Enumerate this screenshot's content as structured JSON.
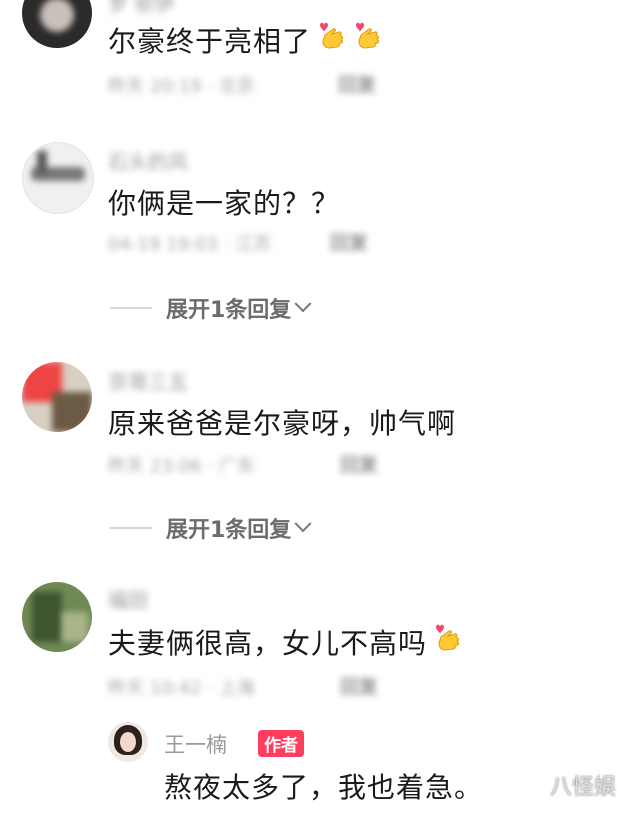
{
  "comments": [
    {
      "username": "罗 依伊",
      "text": "尔豪终于亮相了",
      "emojis": [
        "heart-hands",
        "heart-hands"
      ],
      "time": "昨天 20:19 · 北京",
      "reply_label": "回复"
    },
    {
      "username": "石头的风",
      "text": "你俩是一家的？？",
      "emojis": [],
      "time": "04-19 19:03 · 江苏",
      "reply_label": "回复",
      "expand_label": "展开1条回复"
    },
    {
      "username": "京哥三五",
      "text": "原来爸爸是尔豪呀，帅气啊",
      "emojis": [],
      "time": "昨天 23:06 · 广东",
      "reply_label": "回复",
      "expand_label": "展开1条回复"
    },
    {
      "username": "福田",
      "text": "夫妻俩很高，女儿不高吗",
      "emojis": [
        "heart-hands"
      ],
      "time": "昨天 10:42 · 上海",
      "reply_label": "回复"
    }
  ],
  "author_reply": {
    "username": "王一楠",
    "badge": "作者",
    "text": "熬夜太多了，我也着急。"
  },
  "watermark": "八怪娱",
  "colors": {
    "badge": "#ff3d5f",
    "meta": "#a8a8a8",
    "text": "#1a1a1a"
  }
}
